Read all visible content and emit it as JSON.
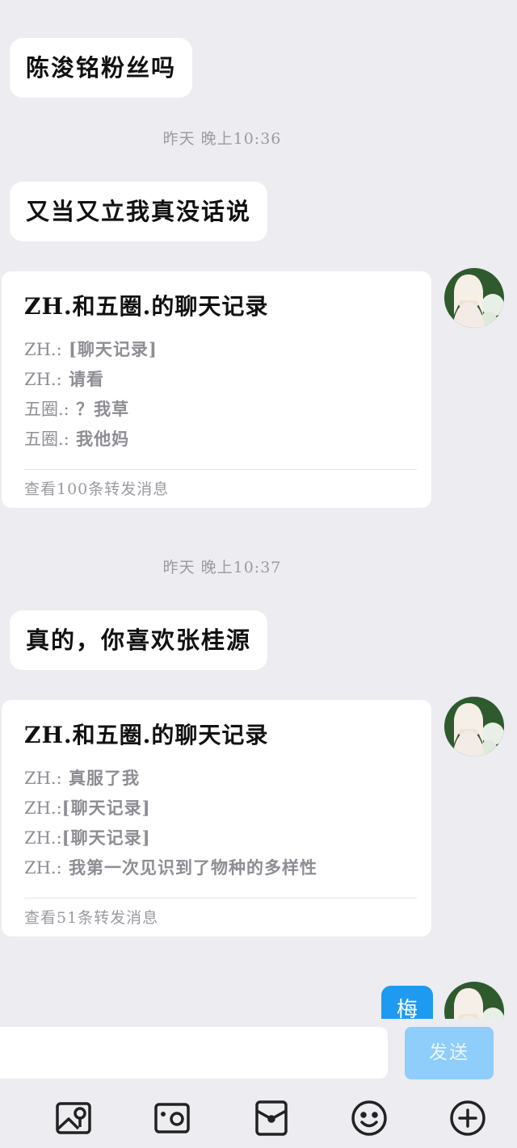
{
  "messages": [
    {
      "text": "陈浚铭粉丝吗"
    },
    {
      "text": "又当又立我真没话说"
    },
    {
      "text": "真的，你喜欢张桂源"
    }
  ],
  "timestamps": [
    "昨天 晚上10:36",
    "昨天 晚上10:37"
  ],
  "forwards": [
    {
      "title": "ZH.和五圈.的聊天记录",
      "lines": [
        {
          "who": "ZH.:",
          "text": "[聊天记录]"
        },
        {
          "who": "ZH.:",
          "text": "请看"
        },
        {
          "who": "五圈.:",
          "text": "？我草"
        },
        {
          "who": "五圈.:",
          "text": "我他妈"
        }
      ],
      "footer": "查看100条转发消息"
    },
    {
      "title": "ZH.和五圈.的聊天记录",
      "lines": [
        {
          "who": "ZH.:",
          "text": "真服了我"
        },
        {
          "who": "ZH.:",
          "text": "[聊天记录]"
        },
        {
          "who": "ZH.:",
          "text": "[聊天记录]"
        },
        {
          "who": "ZH.:",
          "text": "我第一次见识到了物种的多样性"
        }
      ],
      "footer": "查看51条转发消息"
    }
  ],
  "sent_partial": {
    "text": "梅"
  },
  "input": {
    "placeholder": "",
    "value": ""
  },
  "send_label": "发送",
  "toolbar": [
    "image-icon",
    "camera-icon",
    "red-packet-icon",
    "emoji-icon",
    "plus-icon"
  ],
  "colors": {
    "background": "#ececf1",
    "accent": "#1e9bf0",
    "send_disabled": "#8fcdfa"
  }
}
